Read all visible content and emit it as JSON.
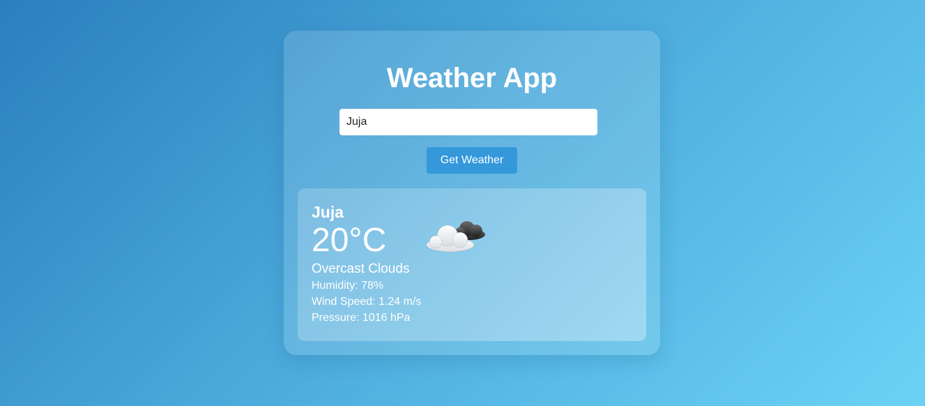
{
  "app": {
    "title": "Weather App"
  },
  "search": {
    "value": "Juja",
    "button_label": "Get Weather"
  },
  "weather": {
    "city": "Juja",
    "temperature": "20°C",
    "description": "Overcast Clouds",
    "humidity": "Humidity: 78%",
    "wind_speed": "Wind Speed: 1.24 m/s",
    "pressure": "Pressure: 1016 hPa",
    "icon": "overcast-clouds-icon"
  },
  "colors": {
    "button": "#3498db",
    "background_start": "#2a7fbd",
    "background_end": "#6bd2f5"
  }
}
